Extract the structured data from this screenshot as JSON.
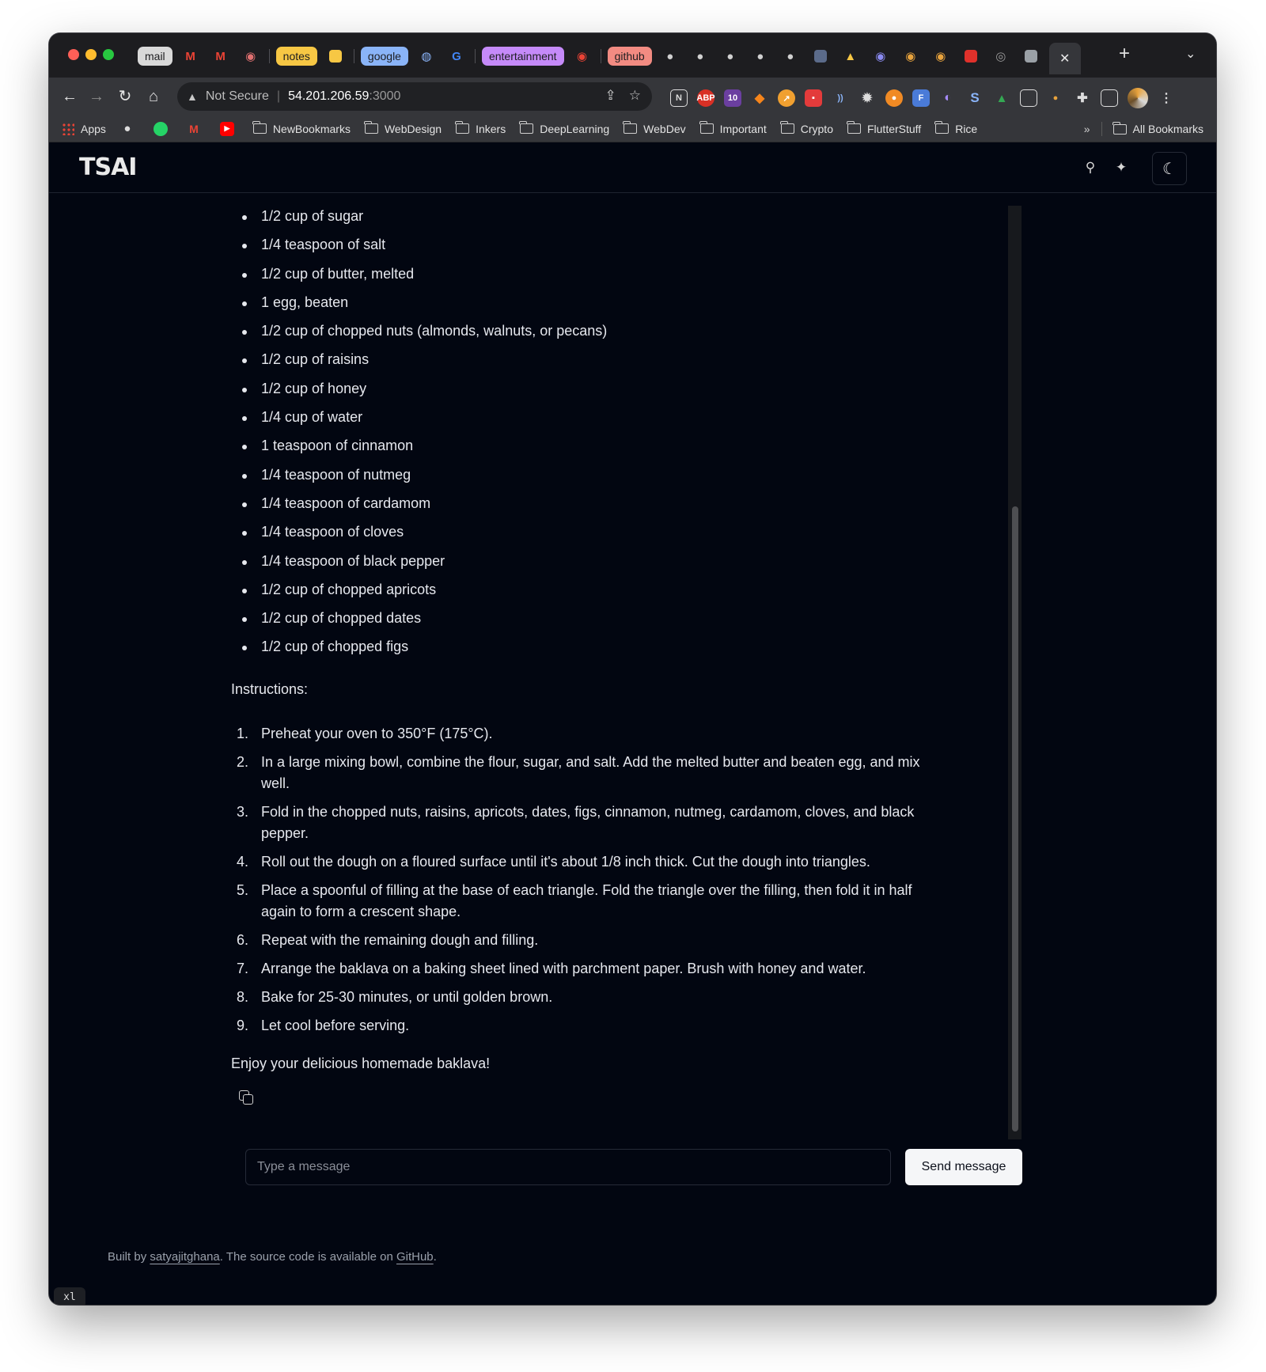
{
  "browser": {
    "tab_groups": [
      {
        "label": "mail",
        "color": "#d9d9d9"
      },
      {
        "label": "notes",
        "color": "#f7c744"
      },
      {
        "label": "google",
        "color": "#8ab4f8"
      },
      {
        "label": "entertainment",
        "color": "#c58af9"
      },
      {
        "label": "github",
        "color": "#f28b82"
      }
    ],
    "active_tab_close": "✕",
    "new_tab": "+",
    "tab_menu": "⌄",
    "address": {
      "warning_icon": "warning-icon",
      "security_label": "Not Secure",
      "host": "54.201.206.59",
      "port": ":3000"
    },
    "bookmarks": [
      {
        "label": "Apps",
        "icon": "apps-grid-icon"
      },
      {
        "label": "NewBookmarks"
      },
      {
        "label": "WebDesign"
      },
      {
        "label": "Inkers"
      },
      {
        "label": "DeepLearning"
      },
      {
        "label": "WebDev"
      },
      {
        "label": "Important"
      },
      {
        "label": "Crypto"
      },
      {
        "label": "FlutterStuff"
      },
      {
        "label": "Rice"
      }
    ],
    "bookmarks_overflow": "»",
    "all_bookmarks": "All Bookmarks"
  },
  "app": {
    "logo": "TSAI",
    "header_icons": [
      "github-icon",
      "twitter-icon",
      "moon-icon"
    ]
  },
  "chat": {
    "ingredients": [
      "1/2 cup of sugar",
      "1/4 teaspoon of salt",
      "1/2 cup of butter, melted",
      "1 egg, beaten",
      "1/2 cup of chopped nuts (almonds, walnuts, or pecans)",
      "1/2 cup of raisins",
      "1/2 cup of honey",
      "1/4 cup of water",
      "1 teaspoon of cinnamon",
      "1/4 teaspoon of nutmeg",
      "1/4 teaspoon of cardamom",
      "1/4 teaspoon of cloves",
      "1/4 teaspoon of black pepper",
      "1/2 cup of chopped apricots",
      "1/2 cup of chopped dates",
      "1/2 cup of chopped figs"
    ],
    "instructions_label": "Instructions:",
    "steps": [
      "Preheat your oven to 350°F (175°C).",
      "In a large mixing bowl, combine the flour, sugar, and salt. Add the melted butter and beaten egg, and mix well.",
      "Fold in the chopped nuts, raisins, apricots, dates, figs, cinnamon, nutmeg, cardamom, cloves, and black pepper.",
      "Roll out the dough on a floured surface until it's about 1/8 inch thick. Cut the dough into triangles.",
      "Place a spoonful of filling at the base of each triangle. Fold the triangle over the filling, then fold it in half again to form a crescent shape.",
      "Repeat with the remaining dough and filling.",
      "Arrange the baklava on a baking sheet lined with parchment paper. Brush with honey and water.",
      "Bake for 25-30 minutes, or until golden brown.",
      "Let cool before serving."
    ],
    "closing": "Enjoy your delicious homemade baklava!"
  },
  "composer": {
    "placeholder": "Type a message",
    "send_label": "Send message"
  },
  "footer": {
    "prefix": "Built by ",
    "author": "satyajitghana",
    "middle": ". The source code is available on ",
    "github": "GitHub",
    "suffix": "."
  },
  "breakpoint_badge": "xl"
}
